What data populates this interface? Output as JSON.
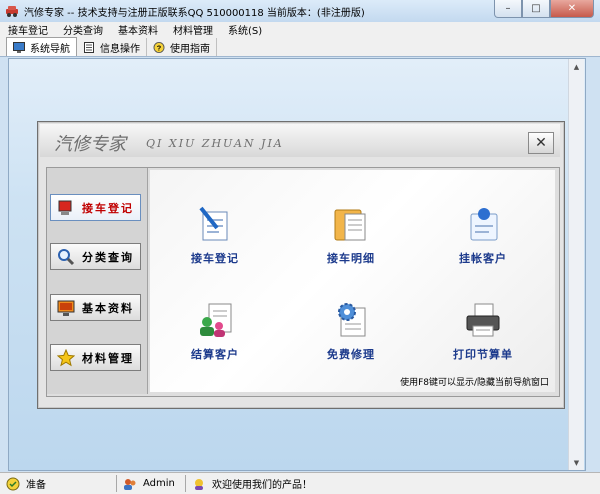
{
  "window": {
    "title": "汽修专家 -- 技术支持与注册正版联系QQ 510000118    当前版本：(非注册版)",
    "minimize": "–",
    "maximize": "□",
    "close": "✕"
  },
  "menu": [
    "接车登记",
    "分类查询",
    "基本资料",
    "材料管理",
    "系统(S)"
  ],
  "toolbar": {
    "tabs": [
      {
        "label": "系统导航",
        "icon": "monitor-icon"
      },
      {
        "label": "信息操作",
        "icon": "document-icon"
      },
      {
        "label": "使用指南",
        "icon": "help-icon"
      }
    ]
  },
  "nav": {
    "title": "汽修专家",
    "subtitle": "QI XIU ZHUAN JIA",
    "close": "✕",
    "side_buttons": [
      {
        "label": "接车登记",
        "icon": "pc-icon",
        "active": true
      },
      {
        "label": "分类查询",
        "icon": "magnifier-icon",
        "active": false
      },
      {
        "label": "基本资料",
        "icon": "monitor-icon",
        "active": false
      },
      {
        "label": "材料管理",
        "icon": "star-icon",
        "active": false
      }
    ],
    "tiles": [
      {
        "label": "接车登记",
        "icon": "pen-paper-icon"
      },
      {
        "label": "接车明细",
        "icon": "folder-doc-icon"
      },
      {
        "label": "挂帐客户",
        "icon": "pin-paper-icon"
      },
      {
        "label": "结算客户",
        "icon": "users-doc-icon"
      },
      {
        "label": "免费修理",
        "icon": "gear-doc-icon"
      },
      {
        "label": "打印节算单",
        "icon": "printer-icon"
      }
    ],
    "hint": "使用F8键可以显示/隐藏当前导航窗口"
  },
  "status": {
    "ready": "准备",
    "user": "Admin",
    "welcome": "欢迎使用我们的产品！"
  },
  "colors": {
    "tile_label": "#1c3a8c",
    "active_side_label": "#c00000",
    "main_bg": "#cde2f3"
  }
}
